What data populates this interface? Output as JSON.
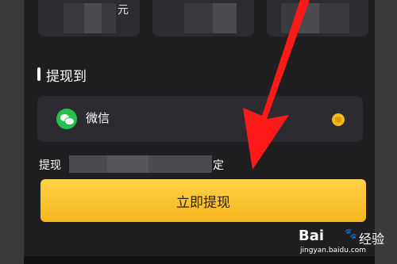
{
  "amount_cards": [
    {
      "unit": "元"
    },
    {
      "unit": ""
    },
    {
      "unit": ""
    }
  ],
  "section": {
    "title": "提现到"
  },
  "payment_method": {
    "label": "微信",
    "icon": "wechat-icon",
    "selected": true
  },
  "note": {
    "start": "提现",
    "end": "定"
  },
  "action": {
    "withdraw_label": "立即提现"
  },
  "watermark": {
    "brand": "Bai",
    "brand_suffix": "经验",
    "url": "jingyan.baidu.com"
  },
  "colors": {
    "accent": "#f6b51d",
    "wechat_green": "#25c04f",
    "annotation_red": "#ff1a1a",
    "background": "#1f1f22"
  }
}
